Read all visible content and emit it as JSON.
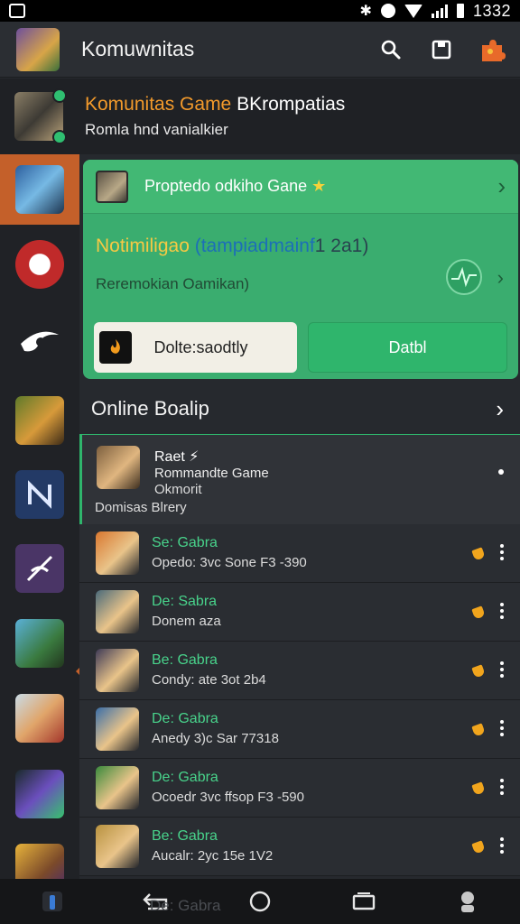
{
  "status_bar": {
    "time": "1332"
  },
  "app_bar": {
    "title": "Komuwnitas",
    "icons": [
      "avatar-icon",
      "search-icon",
      "square-icon",
      "puzzle-icon"
    ]
  },
  "community_header": {
    "title_accent": "Komunitas Game",
    "title_rest": " BKrompatias",
    "subtitle": "Romla hnd vanialkier"
  },
  "sidebar": {
    "items": [
      "game-rifle",
      "game-blade",
      "game-red-circle",
      "game-eye",
      "game-crossbow",
      "game-n-logo",
      "game-pen",
      "game-soldier",
      "game-hat-girl",
      "game-crystal",
      "game-warrior"
    ],
    "active_index": 1
  },
  "promo": {
    "title": "Proptedo odkiho Gane",
    "star": "★",
    "headline_part1": "Notimiligao",
    "headline_part2": " (tampiadmainf",
    "headline_part3": "1 2a1)",
    "description": "Reremokian Oamikan)",
    "button_light": "Dolte:saodtly",
    "button_green": "Datbl"
  },
  "section": {
    "title": "Online Boalip"
  },
  "list_first": {
    "line1": "Raet ⚡",
    "line2": "Rommandte Game",
    "line3": "Okmorit",
    "line4": "Domisas Blrery"
  },
  "list": [
    {
      "name": "Se: Gabra",
      "meta": "Opedo: 3vc Sone F3 -390",
      "color": "#d9772f"
    },
    {
      "name": "De: Sabra",
      "meta": "Donem aza",
      "color": "#4a6a7a"
    },
    {
      "name": "Be: Gabra",
      "meta": "Condy: ate 3ot 2b4",
      "color": "#3e3a56"
    },
    {
      "name": "De: Gabra",
      "meta": "Anedy 3)c Sar 77318",
      "color": "#3a6ea8"
    },
    {
      "name": "De: Gabra",
      "meta": "Ocoedr 3vc ffsop F3 -590",
      "color": "#3a8a3c"
    },
    {
      "name": "Be: Gabra",
      "meta": "Aucalr: 2yc 15e 1V2",
      "color": "#b8923f"
    }
  ],
  "nav_bar": {
    "ghost_text": "De: Gabra"
  }
}
